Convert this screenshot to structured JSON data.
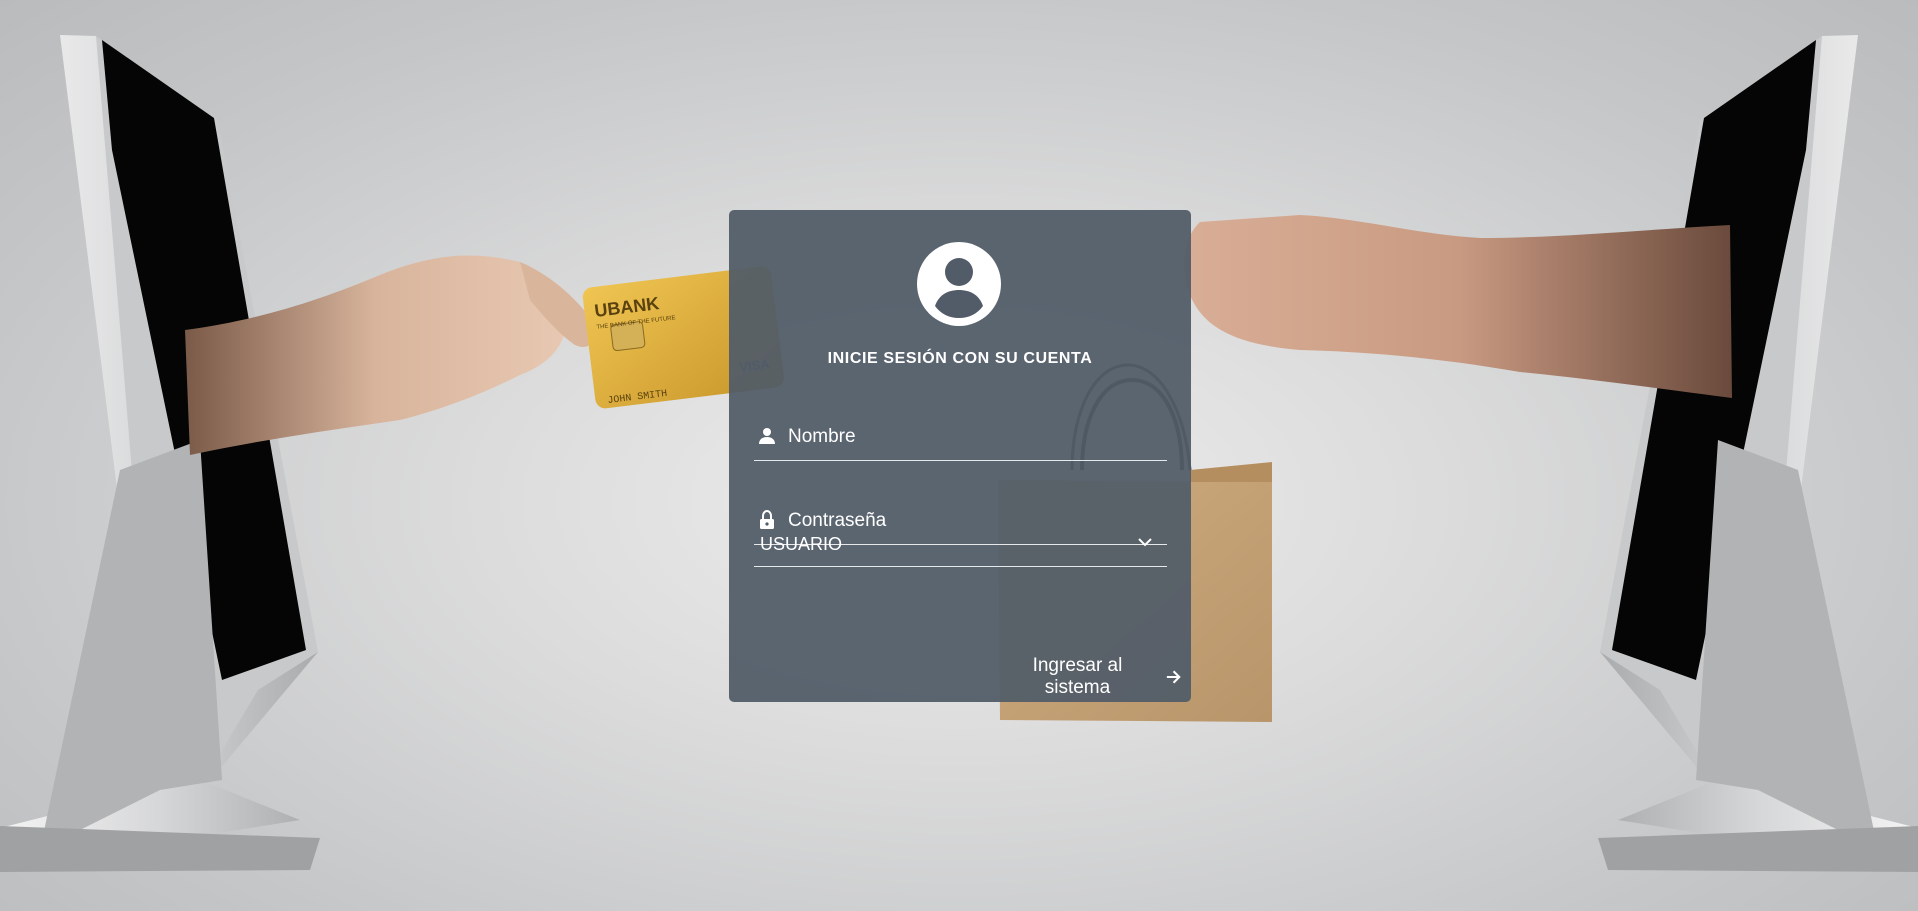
{
  "login": {
    "title": "INICIE SESIÓN CON SU CUENTA",
    "username_placeholder": "Nombre",
    "password_placeholder": "Contraseña",
    "role_select": {
      "selected": "USUARIO"
    },
    "submit_label": "Ingresar al sistema"
  },
  "icons": {
    "avatar": "account-circle-icon",
    "user": "person-icon",
    "password": "lock-icon",
    "select": "chevron-down-icon",
    "submit": "arrow-right-icon"
  },
  "colors": {
    "card_background": "#525c68",
    "text": "#ffffff",
    "underline": "#e6e8ea",
    "card_gold": "#e0b43a",
    "bag_kraft": "#c9a678"
  },
  "background": {
    "card_brand": "UBANK",
    "card_tagline": "THE BANK OF THE FUTURE",
    "card_holder": "JOHN SMITH",
    "card_network": "VISA"
  }
}
